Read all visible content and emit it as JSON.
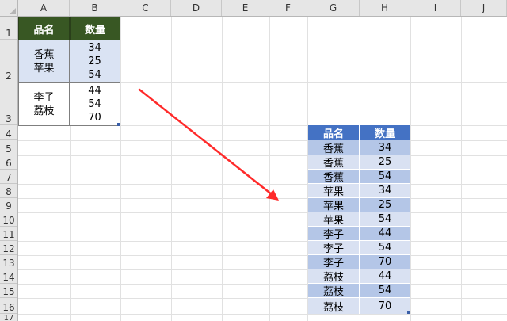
{
  "columns": [
    "A",
    "B",
    "C",
    "D",
    "E",
    "F",
    "G",
    "H",
    "I",
    "J"
  ],
  "rows": [
    "1",
    "2",
    "3",
    "4",
    "5",
    "6",
    "7",
    "8",
    "9",
    "10",
    "11",
    "12",
    "13",
    "14",
    "15",
    "16",
    "17"
  ],
  "source_table": {
    "headers": [
      "品名",
      "数量"
    ],
    "groups": [
      {
        "names": [
          "香蕉",
          "苹果"
        ],
        "values": [
          "34",
          "25",
          "54"
        ]
      },
      {
        "names": [
          "李子",
          "荔枝"
        ],
        "values": [
          "44",
          "54",
          "70"
        ]
      }
    ]
  },
  "result_table": {
    "headers": [
      "品名",
      "数量"
    ],
    "rows": [
      [
        "香蕉",
        "34"
      ],
      [
        "香蕉",
        "25"
      ],
      [
        "香蕉",
        "54"
      ],
      [
        "苹果",
        "34"
      ],
      [
        "苹果",
        "25"
      ],
      [
        "苹果",
        "54"
      ],
      [
        "李子",
        "44"
      ],
      [
        "李子",
        "54"
      ],
      [
        "李子",
        "70"
      ],
      [
        "荔枝",
        "44"
      ],
      [
        "荔枝",
        "54"
      ],
      [
        "荔枝",
        "70"
      ]
    ]
  },
  "colors": {
    "source_header": "#385723",
    "result_header": "#4472c4",
    "band_dark": "#b4c6e7",
    "band_light": "#d9e1f2",
    "arrow": "#ff2a2a"
  }
}
